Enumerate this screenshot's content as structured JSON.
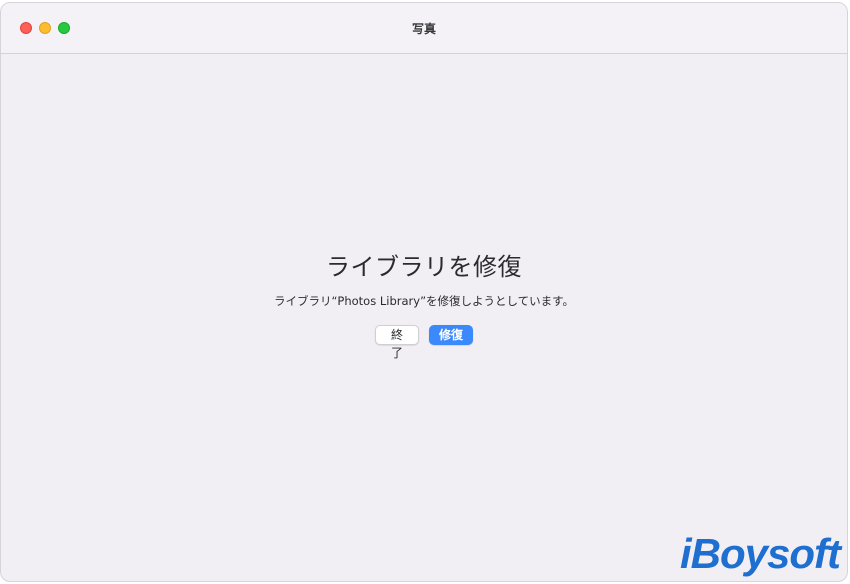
{
  "window": {
    "title": "写真"
  },
  "dialog": {
    "title": "ライブラリを修復",
    "message": "ライブラリ“Photos Library”を修復しようとしています。",
    "buttons": {
      "quit_label": "終了",
      "repair_label": "修復"
    }
  },
  "watermark": {
    "text": "iBoysoft"
  },
  "colors": {
    "accent": "#3b89fb",
    "window_background": "#f1eff4",
    "traffic_close": "#fe5f57",
    "traffic_minimize": "#febc2e",
    "traffic_zoom": "#28c840",
    "watermark": "#1e6fd0"
  }
}
